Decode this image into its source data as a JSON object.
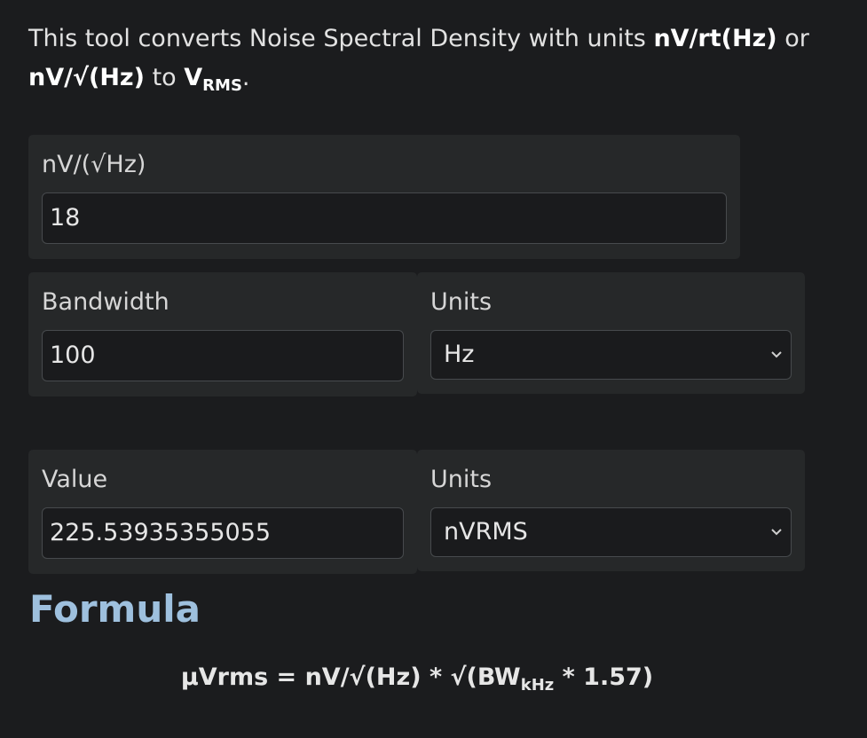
{
  "intro": {
    "text1": "This tool converts Noise Spectral Density with units ",
    "unit1": "nV/rt(Hz)",
    "text2": " or ",
    "unit2": "nV/√(Hz)",
    "text3": " to ",
    "vrms_main": "V",
    "vrms_sub": "RMS",
    "text4": "."
  },
  "nsd": {
    "label": "nV/(√Hz)",
    "value": "18"
  },
  "bandwidth": {
    "label": "Bandwidth",
    "value": "100",
    "units_label": "Units",
    "units_value": "Hz"
  },
  "result": {
    "label": "Value",
    "value": "225.53935355055",
    "units_label": "Units",
    "units_value": "nVRMS"
  },
  "formula": {
    "title": "Formula",
    "part1": "μVrms = nV/√(Hz) * √(BW",
    "sub": "kHz",
    "part2": " * 1.57)"
  },
  "icons": {
    "select_chevron": "chevron-down-icon"
  }
}
